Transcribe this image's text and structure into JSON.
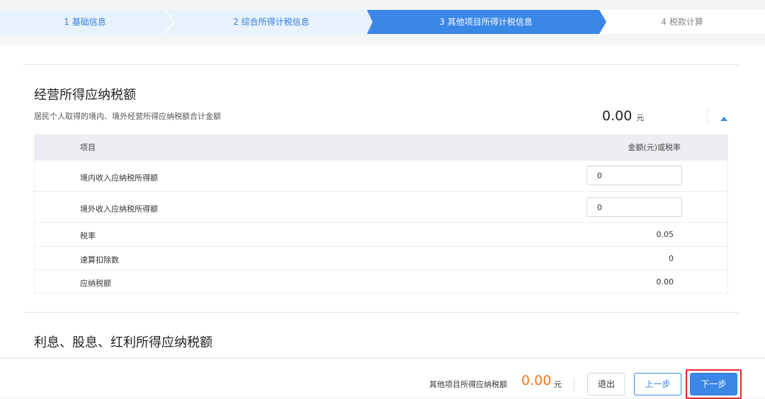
{
  "steps": [
    {
      "label": "1 基础信息"
    },
    {
      "label": "2 综合所得计税信息"
    },
    {
      "label": "3 其他项目所得计税信息"
    },
    {
      "label": "4 税款计算"
    }
  ],
  "section1": {
    "title": "经营所得应纳税额",
    "desc": "居民个人取得的境内、境外经营所得应纳税额合计金额",
    "amount": "0.00",
    "unit": "元",
    "collapse_icon": "caret-up-icon",
    "table": {
      "headers": {
        "item": "项目",
        "amount": "金额(元)或税率"
      },
      "rows": [
        {
          "label": "境内收入应纳税所得额",
          "input_value": "0"
        },
        {
          "label": "境外收入应纳税所得额",
          "input_value": "0"
        },
        {
          "label": "税率",
          "value": "0.05"
        },
        {
          "label": "速算扣除数",
          "value": "0"
        },
        {
          "label": "应纳税额",
          "value": "0.00"
        }
      ]
    }
  },
  "section2": {
    "title": "利息、股息、红利所得应纳税额"
  },
  "footer": {
    "label": "其他项目所得应纳税额",
    "amount": "0.00",
    "unit": "元",
    "exit": "退出",
    "prev": "上一步",
    "next": "下一步"
  },
  "colors": {
    "accent": "#3a87e8",
    "step_inactive_bg": "#e8f2fc",
    "amount_orange": "#f0781e",
    "highlight_red": "#e3262f"
  }
}
